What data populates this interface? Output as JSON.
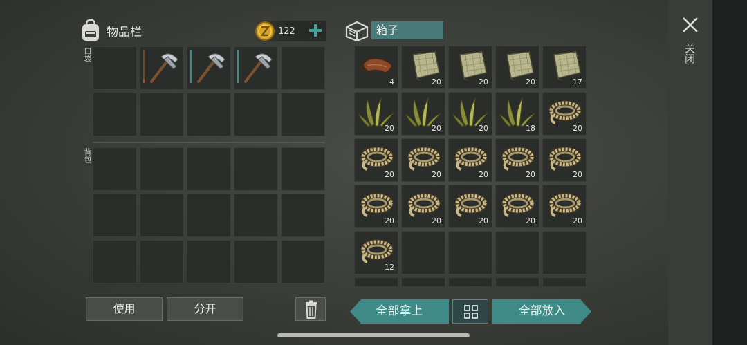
{
  "inventory": {
    "title": "物品栏",
    "coins": "122",
    "pocket_label": "口袋",
    "backpack_label": "背包",
    "pocket_slots": [
      {
        "item": "",
        "count": ""
      },
      {
        "item": "pickaxe-icon",
        "count": ""
      },
      {
        "item": "pickaxe-icon",
        "count": ""
      },
      {
        "item": "pickaxe-icon",
        "count": ""
      },
      {
        "item": "",
        "count": ""
      },
      {
        "item": "",
        "count": ""
      },
      {
        "item": "",
        "count": ""
      },
      {
        "item": "",
        "count": ""
      },
      {
        "item": "",
        "count": ""
      },
      {
        "item": "",
        "count": ""
      }
    ],
    "backpack_slots": 15
  },
  "box": {
    "title": "箱子",
    "slots": [
      {
        "item": "leather-icon",
        "count": "4"
      },
      {
        "item": "cloth-icon",
        "count": "20"
      },
      {
        "item": "cloth-icon",
        "count": "20"
      },
      {
        "item": "cloth-icon",
        "count": "20"
      },
      {
        "item": "cloth-icon",
        "count": "17"
      },
      {
        "item": "grass-icon",
        "count": "20"
      },
      {
        "item": "grass-icon",
        "count": "20"
      },
      {
        "item": "grass-icon",
        "count": "20"
      },
      {
        "item": "grass-icon",
        "count": "18"
      },
      {
        "item": "rope-icon",
        "count": "20"
      },
      {
        "item": "rope-icon",
        "count": "20"
      },
      {
        "item": "rope-icon",
        "count": "20"
      },
      {
        "item": "rope-icon",
        "count": "20"
      },
      {
        "item": "rope-icon",
        "count": "20"
      },
      {
        "item": "rope-icon",
        "count": "20"
      },
      {
        "item": "rope-icon",
        "count": "20"
      },
      {
        "item": "rope-icon",
        "count": "20"
      },
      {
        "item": "rope-icon",
        "count": "20"
      },
      {
        "item": "rope-icon",
        "count": "20"
      },
      {
        "item": "rope-icon",
        "count": "20"
      },
      {
        "item": "rope-icon",
        "count": "12"
      },
      {
        "item": "",
        "count": ""
      },
      {
        "item": "",
        "count": ""
      },
      {
        "item": "",
        "count": ""
      },
      {
        "item": "",
        "count": ""
      },
      {
        "item": "",
        "count": ""
      },
      {
        "item": "",
        "count": ""
      },
      {
        "item": "",
        "count": ""
      },
      {
        "item": "",
        "count": ""
      },
      {
        "item": "",
        "count": ""
      }
    ]
  },
  "buttons": {
    "use": "使用",
    "split": "分开",
    "take_all": "全部拿上",
    "put_all": "全部放入",
    "close": "关闭"
  },
  "colors": {
    "accent": "#3f8a86",
    "slot": "#2b2d2b",
    "box_title_bg": "#4a7a78"
  }
}
